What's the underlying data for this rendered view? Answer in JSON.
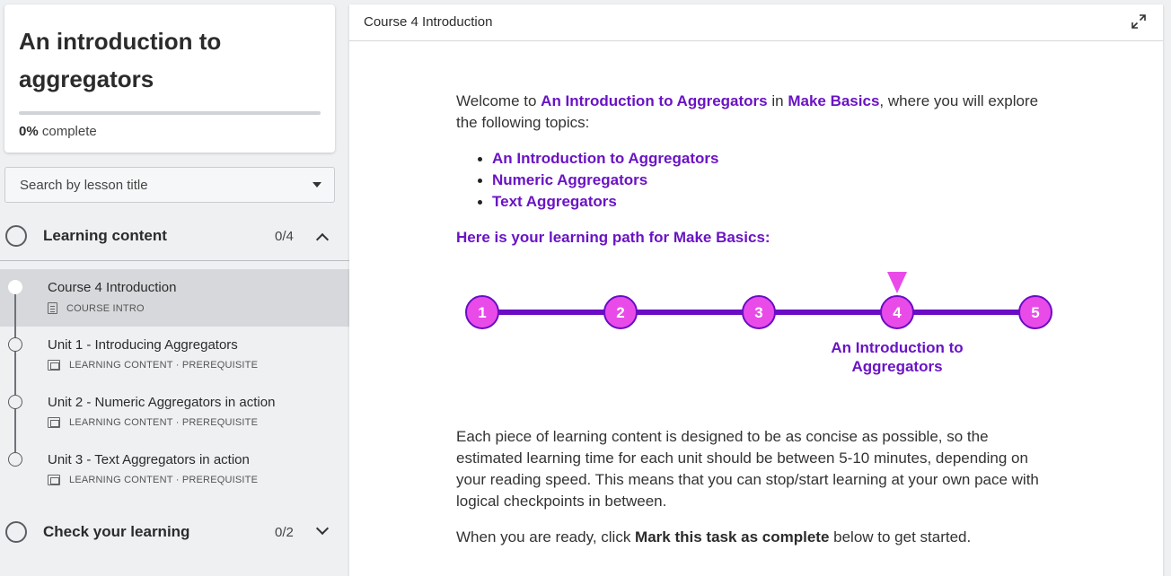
{
  "sidebar": {
    "course_title": "An introduction to aggregators",
    "progress_percent": 0,
    "progress_value": "0%",
    "progress_suffix": "complete",
    "search_placeholder": "Search by lesson title",
    "sections": [
      {
        "label": "Learning content",
        "count": "0/4",
        "expanded": true
      },
      {
        "label": "Check your learning",
        "count": "0/2",
        "expanded": false
      }
    ],
    "lessons": [
      {
        "title": "Course 4 Introduction",
        "meta": "COURSE INTRO",
        "icon": "document-icon",
        "active": true
      },
      {
        "title": "Unit 1 - Introducing Aggregators",
        "meta": "LEARNING CONTENT · PREREQUISITE",
        "icon": "screen-icon",
        "active": false
      },
      {
        "title": "Unit 2 - Numeric Aggregators in action",
        "meta": "LEARNING CONTENT · PREREQUISITE",
        "icon": "screen-icon",
        "active": false
      },
      {
        "title": "Unit 3 - Text Aggregators in action",
        "meta": "LEARNING CONTENT · PREREQUISITE",
        "icon": "screen-icon",
        "active": false
      }
    ]
  },
  "main": {
    "header_title": "Course 4 Introduction",
    "intro": {
      "prefix": "Welcome to ",
      "course_link": "An Introduction to Aggregators",
      "mid": " in ",
      "path_link": "Make Basics",
      "suffix": ", where you will explore the following topics:"
    },
    "topics": [
      "An Introduction to Aggregators",
      "Numeric Aggregators",
      "Text Aggregators"
    ],
    "path_heading": "Here is your learning path for Make Basics:",
    "learning_path": {
      "steps": [
        "1",
        "2",
        "3",
        "4",
        "5"
      ],
      "current_step": 4,
      "current_label_line1": "An Introduction to",
      "current_label_line2": "Aggregators",
      "colors": {
        "line": "#6a0dc4",
        "node": "#e94be9",
        "label": "#6a14c4"
      }
    },
    "body_paragraph": "Each piece of learning content is designed to be as concise as possible, so the estimated learning time for each unit should be between 5-10 minutes, depending on your reading speed. This means that you can stop/start learning at your own pace with logical checkpoints in between.",
    "closing": {
      "prefix": "When you are ready, click ",
      "bold": "Mark this task as complete",
      "suffix": " below to get started."
    }
  }
}
